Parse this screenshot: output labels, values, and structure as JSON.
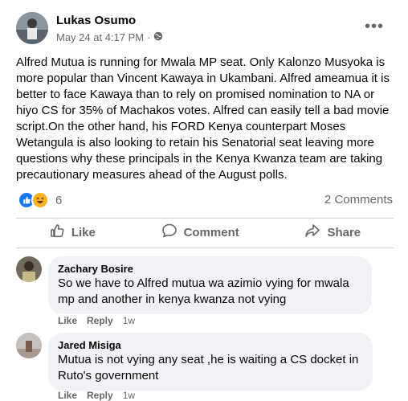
{
  "post": {
    "author": "Lukas Osumo",
    "timestamp": "May 24 at 4:17 PM",
    "separator": "·",
    "more_label": "•••",
    "text": "Alfred Mutua is running for Mwala MP seat. Only Kalonzo Musyoka is more popular than Vincent Kawaya in Ukambani. Alfred ameamua it is better to face Kawaya than to rely on promised nomination to NA or hiyo CS for 35% of Machakos votes. Alfred can easily tell a bad movie script.On the other hand, his FORD Kenya counterpart Moses Wetangula is also  looking to retain his Senatorial seat leaving more questions why these principals in the Kenya Kwanza team are taking precautionary measures ahead of the August polls.",
    "reaction_count": "6",
    "comments_count": "2 Comments",
    "privacy_icon": "globe-icon"
  },
  "actions": {
    "like": "Like",
    "comment": "Comment",
    "share": "Share"
  },
  "comments": [
    {
      "name": "Zachary Bosire",
      "text": "So we have to Alfred mutua wa azimio vying for mwala mp and another in kenya kwanza not vying",
      "like": "Like",
      "reply": "Reply",
      "time": "1w"
    },
    {
      "name": "Jared Misiga",
      "text": "Mutua is not vying any seat ,he is waiting a CS docket in Ruto's government",
      "like": "Like",
      "reply": "Reply",
      "time": "1w"
    }
  ],
  "colors": {
    "like_blue": "#1877f2",
    "secondary_text": "#65676b",
    "bubble_bg": "#f0f2f5"
  }
}
